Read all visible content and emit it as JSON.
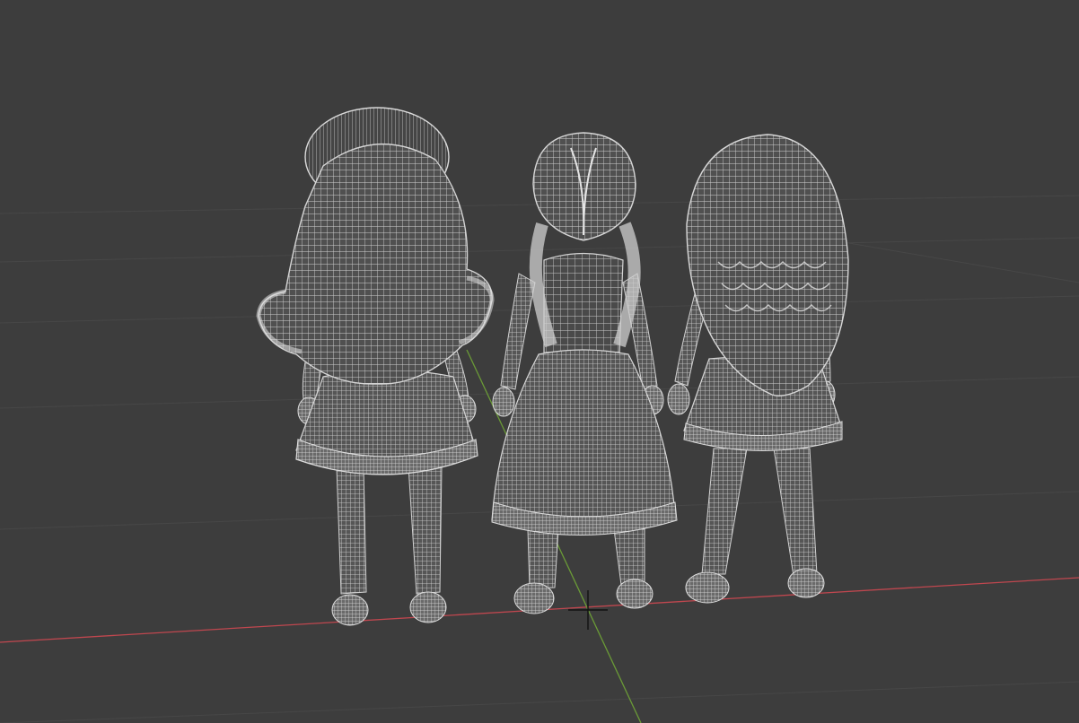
{
  "viewport": {
    "mode": "3D viewport",
    "shading": "wireframe",
    "background_color": "#3d3d3d",
    "grid_line_color": "#474747",
    "x_axis_color": "#c0474f",
    "y_axis_color": "#6a9a37",
    "wire_color": "#d4d4d4",
    "mesh_fill_color": "#525252",
    "cursor_color": "#111111"
  },
  "objects": [
    {
      "name": "doll-with-bonnet",
      "view": "back"
    },
    {
      "name": "doll-with-braids",
      "view": "back"
    },
    {
      "name": "doll-with-long-hair",
      "view": "back"
    }
  ]
}
